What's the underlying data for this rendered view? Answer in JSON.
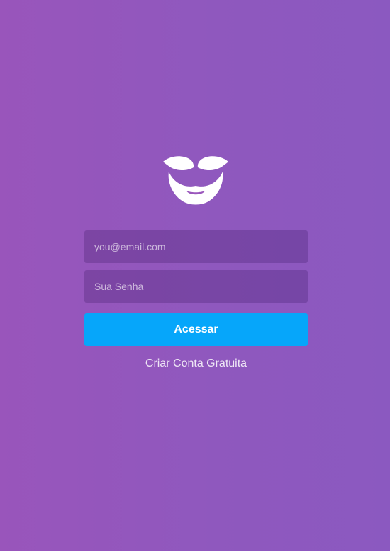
{
  "logo": {
    "icon": "mustache-beard-icon",
    "color": "#ffffff"
  },
  "login": {
    "email_placeholder": "you@email.com",
    "password_placeholder": "Sua Senha",
    "submit_label": "Acessar",
    "signup_label": "Criar Conta Gratuita"
  },
  "colors": {
    "background_start": "#9955bb",
    "background_end": "#8b59c0",
    "primary_button": "#06a6fa",
    "text": "#ffffff"
  }
}
